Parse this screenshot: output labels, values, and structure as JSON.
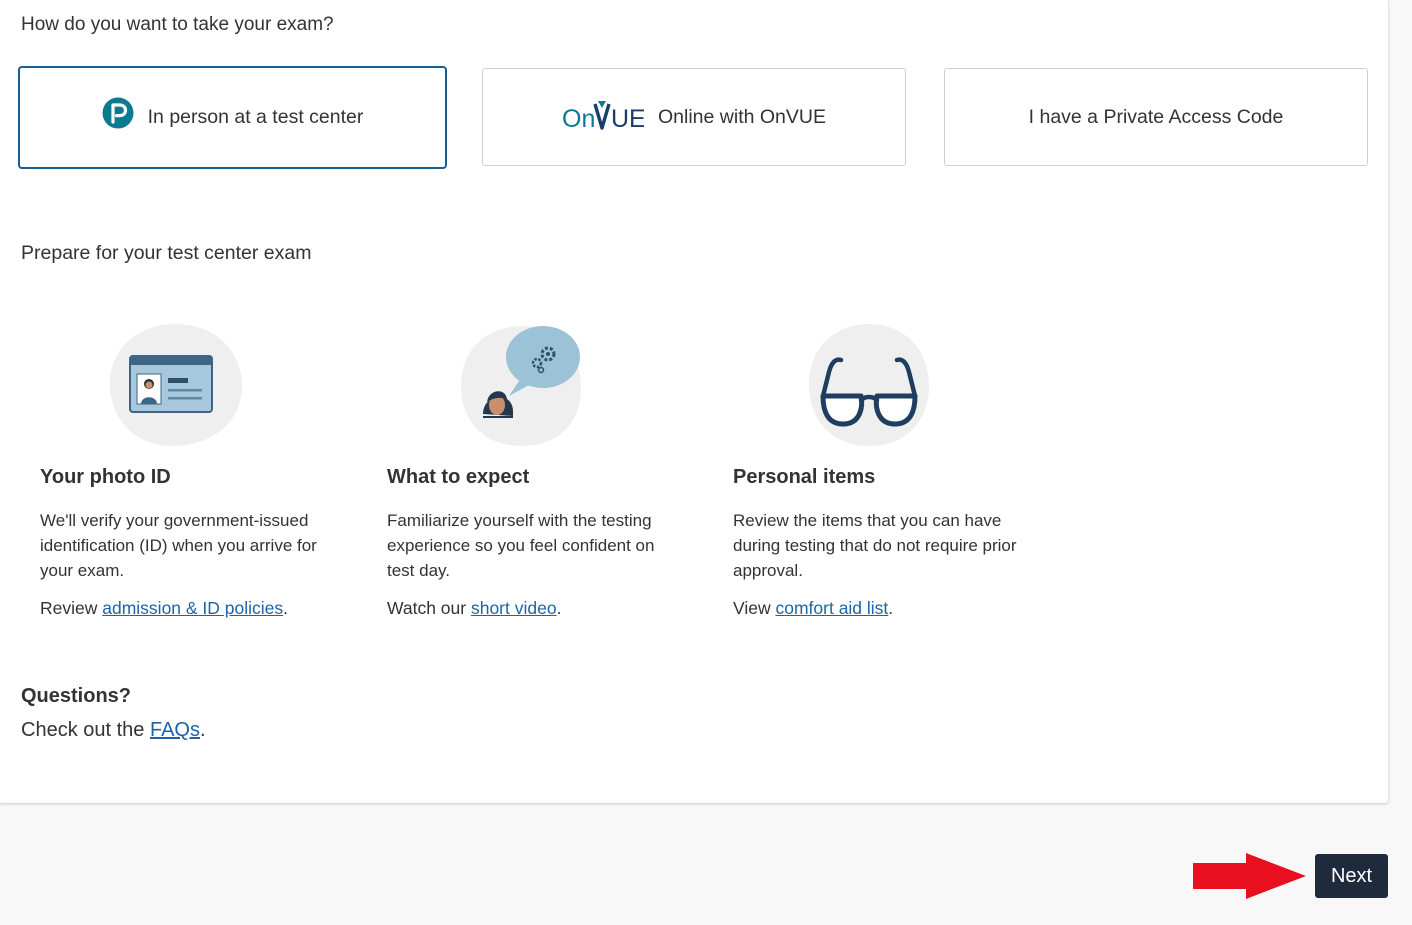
{
  "question": "How do you want to take your exam?",
  "options": [
    {
      "label": "In person at a test center",
      "icon": "pearson-logo-icon",
      "selected": true
    },
    {
      "label": "Online with OnVUE",
      "icon": "onvue-logo-icon",
      "logo_text_on": "On",
      "logo_text_vue": "UE",
      "selected": false
    },
    {
      "label": "I have a Private Access Code",
      "selected": false
    }
  ],
  "prepare": {
    "title": "Prepare for your test center exam",
    "items": [
      {
        "title": "Your photo ID",
        "icon": "id-card-icon",
        "description": "We'll verify your government-issued identification (ID) when you arrive for your exam.",
        "prefix": "Review ",
        "link": "admission & ID policies",
        "suffix": "."
      },
      {
        "title": "What to expect",
        "icon": "person-thinking-icon",
        "description": "Familiarize yourself with the testing experience so you feel confident on test day.",
        "prefix": "Watch our ",
        "link": "short video",
        "suffix": "."
      },
      {
        "title": "Personal items",
        "icon": "eyeglasses-icon",
        "description": "Review the items that you can have during testing that do not require prior approval.",
        "prefix": "View ",
        "link": "comfort aid list",
        "suffix": "."
      }
    ]
  },
  "questions": {
    "title": "Questions?",
    "prefix": "Check out the ",
    "link": "FAQs",
    "suffix": "."
  },
  "next_button": "Next",
  "colors": {
    "selected_border": "#1a5e8f",
    "link": "#1f63a7",
    "next_bg": "#1f2b3c",
    "arrow": "#e8101f",
    "pearson_teal": "#0b7a91"
  }
}
